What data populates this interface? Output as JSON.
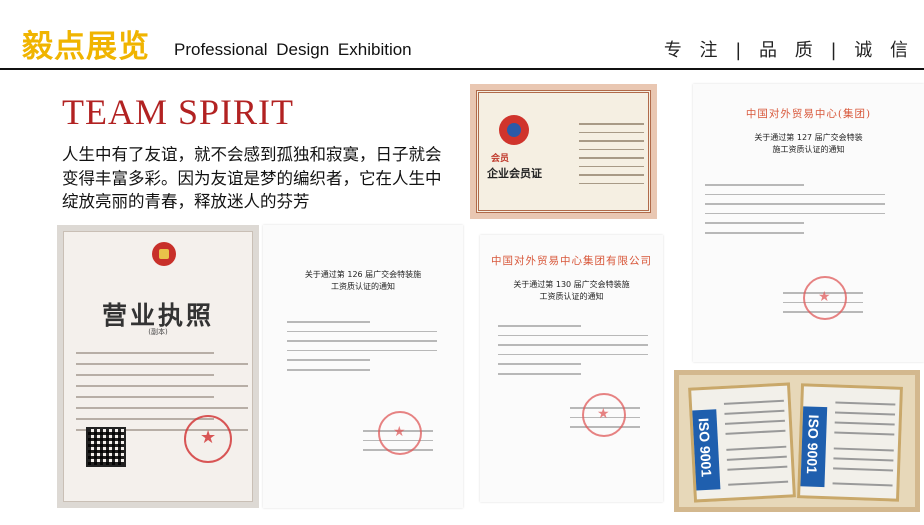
{
  "header": {
    "brand": "毅点展览",
    "subtitle": "Professional  Design Exhibition",
    "slogan": "专 注 | 品 质 | 诚 信"
  },
  "section": {
    "title": "TEAM SPIRIT",
    "intro": "人生中有了友谊，就不会感到孤独和寂寞，日子就会变得丰富多彩。因为友谊是梦的编织者，它在人生中绽放亮丽的青春，释放迷人的芬芳"
  },
  "documents": {
    "license": {
      "title": "营业执照",
      "copy_label": "(副本)"
    },
    "notice_126": {
      "heading": "关于通过第 126 届广交会特装施工资质认证的通知"
    },
    "notice_130": {
      "org": "中国对外贸易中心集团有限公司",
      "heading": "关于通过第 130 届广交会特装施工资质认证的通知"
    },
    "notice_127": {
      "org": "中国对外贸易中心(集团)",
      "heading": "关于通过第 127 届广交会特装施工资质认证的通知"
    },
    "membership": {
      "badge": "会员",
      "title": "企业会员证"
    },
    "iso": {
      "label": "ISO 9001"
    }
  }
}
